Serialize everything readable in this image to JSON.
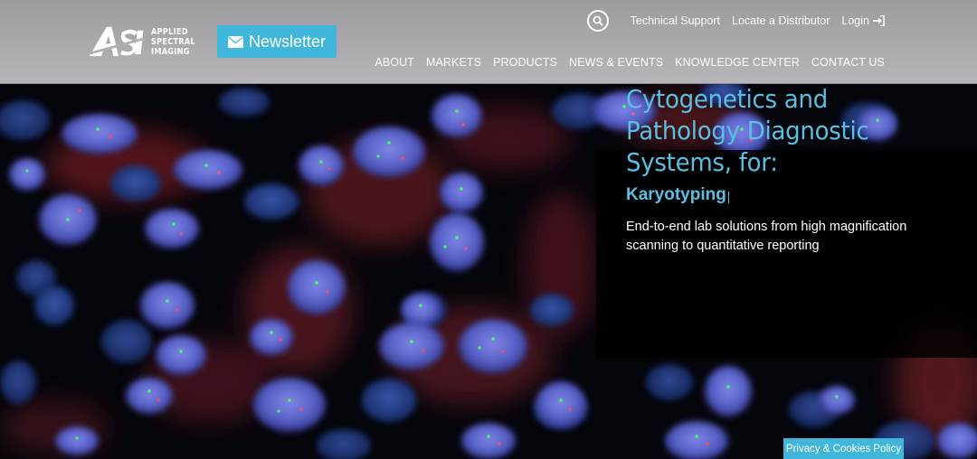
{
  "logo": {
    "mark": "ASI",
    "lines": [
      "APPLIED",
      "SPECTRAL",
      "IMAGING"
    ]
  },
  "header": {
    "newsletter_label": "Newsletter",
    "top_links": {
      "technical_support": "Technical Support",
      "locate_distributor": "Locate a Distributor",
      "login": "Login"
    },
    "nav": [
      "ABOUT",
      "MARKETS",
      "PRODUCTS",
      "NEWS & EVENTS",
      "KNOWLEDGE CENTER",
      "CONTACT US"
    ]
  },
  "hero": {
    "title": "Cytogenetics and Pathology Diagnostic Systems, for:",
    "rotating_text": "Karyotyping",
    "description": "End-to-end lab solutions from high magnification scanning to quantitative reporting"
  },
  "footer": {
    "privacy_label": "Privacy & Cookies Policy"
  },
  "colors": {
    "accent": "#3fb6da",
    "hero_title": "#5cbfe0",
    "header_bg": "#a7a7ab"
  },
  "icons": {
    "search": "search-icon",
    "newsletter": "envelope-icon",
    "login": "sign-in-icon"
  }
}
